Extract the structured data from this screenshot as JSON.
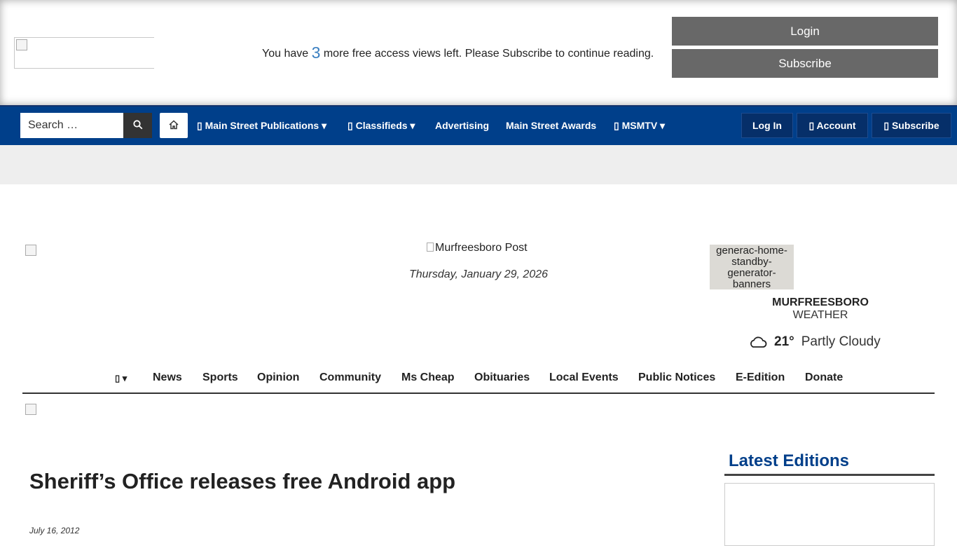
{
  "paywall": {
    "msg_before": "You have",
    "views_left": "3",
    "msg_after": "more free access views left. Please Subscribe to continue reading.",
    "login_label": "Login",
    "subscribe_label": "Subscribe"
  },
  "topnav": {
    "search_placeholder": "Search …",
    "search_icon": "search-icon",
    "home_icon": "home-icon",
    "items": [
      {
        "label": "Main Street Publications ▾",
        "icon": "building-icon"
      },
      {
        "label": "Classifieds ▾",
        "icon": "tag-icon"
      },
      {
        "label": "Advertising"
      },
      {
        "label": "Main Street Awards"
      },
      {
        "label": "MSMTV ▾",
        "icon": "tv-icon"
      }
    ],
    "buttons": [
      {
        "label": "Log In"
      },
      {
        "label": "Account",
        "icon": "user-icon"
      },
      {
        "label": "Subscribe",
        "icon": "newspaper-icon"
      }
    ],
    "accent_color": "#003f8a"
  },
  "masthead": {
    "logo_alt": "Murfreesboro Post",
    "date": "Thursday, January 29, 2026",
    "ad_alt": "generac-home-standby-generator-banners",
    "weather_city": "MURFREESBORO",
    "weather_label": "WEATHER",
    "weather_icon": "cloud-icon",
    "temperature": "21°",
    "condition": "Partly Cloudy"
  },
  "secnav": {
    "menu_icon": "bars-icon",
    "items": [
      "News",
      "Sports",
      "Opinion",
      "Community",
      "Ms Cheap",
      "Obituaries",
      "Local Events",
      "Public Notices",
      "E-Edition",
      "Donate"
    ]
  },
  "article": {
    "headline": "Sheriff’s Office releases free Android app",
    "date": "July 16, 2012"
  },
  "sidebar": {
    "latest_title": "Latest Editions"
  }
}
